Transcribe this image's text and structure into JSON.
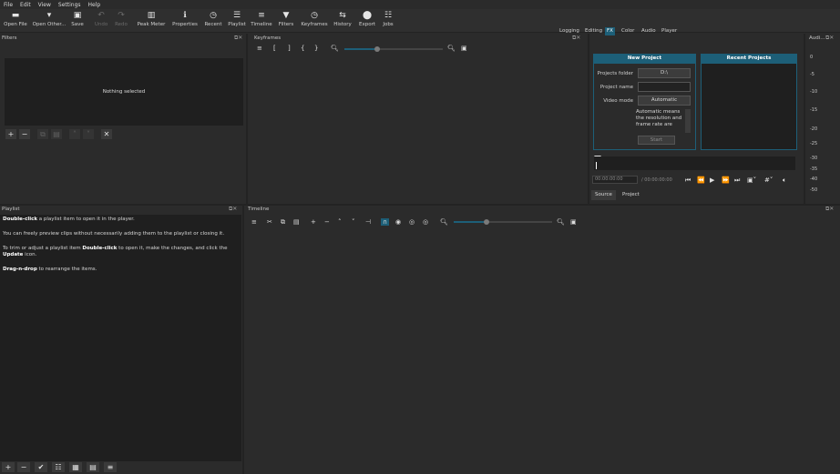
{
  "menu": [
    "File",
    "Edit",
    "View",
    "Settings",
    "Help"
  ],
  "toolbar": [
    {
      "label": "Open File",
      "icon": "folder-icon",
      "glyph": "▬"
    },
    {
      "label": "Open Other...",
      "icon": "open-other-icon",
      "glyph": "▾"
    },
    {
      "label": "Save",
      "icon": "save-icon",
      "glyph": "▣"
    },
    {
      "label": "Undo",
      "icon": "undo-icon",
      "glyph": "↶"
    },
    {
      "label": "Redo",
      "icon": "redo-icon",
      "glyph": "↷"
    },
    {
      "label": "Peak Meter",
      "icon": "peak-meter-icon",
      "glyph": "▥"
    },
    {
      "label": "Properties",
      "icon": "properties-icon",
      "glyph": "ℹ"
    },
    {
      "label": "Recent",
      "icon": "recent-icon",
      "glyph": "◷"
    },
    {
      "label": "Playlist",
      "icon": "playlist-icon",
      "glyph": "☰"
    },
    {
      "label": "Timeline",
      "icon": "timeline-icon",
      "glyph": "≡"
    },
    {
      "label": "Filters",
      "icon": "filter-icon",
      "glyph": "▼"
    },
    {
      "label": "Keyframes",
      "icon": "keyframes-icon",
      "glyph": "◷"
    },
    {
      "label": "History",
      "icon": "history-icon",
      "glyph": "⇆"
    },
    {
      "label": "Export",
      "icon": "export-icon",
      "glyph": "⬤"
    },
    {
      "label": "Jobs",
      "icon": "jobs-icon",
      "glyph": "☷"
    }
  ],
  "workspaces": [
    "Logging",
    "Editing",
    "FX",
    "Color",
    "Audio",
    "Player"
  ],
  "active_workspace": "FX",
  "filters": {
    "title": "Filters",
    "empty_text": "Nothing selected"
  },
  "keyframes": {
    "title": "Keyframes"
  },
  "audio_panel": {
    "title": "Audi..."
  },
  "meter": {
    "labels": [
      "0",
      "-5",
      "-10",
      "-15",
      "-20",
      "-25",
      "-30",
      "-35",
      "-40",
      "-50"
    ]
  },
  "new_project": {
    "title": "New Project",
    "folder_label": "Projects folder",
    "folder_value": "D:\\",
    "name_label": "Project name",
    "name_value": "",
    "mode_label": "Video mode",
    "mode_value": "Automatic",
    "description": "Automatic means the resolution and frame rate are",
    "start_label": "Start"
  },
  "recent_projects": {
    "title": "Recent Projects"
  },
  "player": {
    "timecode": "00:00:00:00",
    "duration": "/ 00:00:00:00",
    "tabs": [
      "Source",
      "Project"
    ]
  },
  "playlist": {
    "title": "Playlist",
    "lines": [
      {
        "bold": "Double-click",
        "rest": " a playlist item to open it in the player."
      },
      {
        "bold": "",
        "rest": "You can freely preview clips without necessarily adding them to the playlist or closing it."
      },
      {
        "bold": "",
        "rest": "To trim or adjust a playlist item ",
        "bold2": "Double-click",
        "rest2": " to open it, make the changes, and click the ",
        "bold3": "Update",
        "rest3": " icon."
      },
      {
        "bold": "Drag-n-drop",
        "rest": " to rearrange the items."
      }
    ]
  },
  "timeline": {
    "title": "Timeline"
  },
  "colors": {
    "accent": "#1d5f78",
    "panel": "#2b2b2b",
    "dark": "#1f1f1f"
  }
}
